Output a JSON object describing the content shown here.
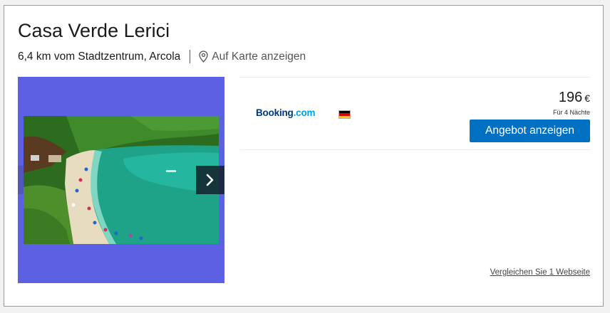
{
  "hotel": {
    "name": "Casa Verde Lerici",
    "distance_text": "6,4 km vom Stadtzentrum, Arcola",
    "map_link_label": "Auf Karte anzeigen"
  },
  "gallery": {
    "background_color": "#5c60e3",
    "next_icon": "chevron-right-icon"
  },
  "deal": {
    "provider_part1": "Booking",
    "provider_part2": ".com",
    "provider_colors": {
      "part1": "#003580",
      "part2": "#009fe3"
    },
    "flag": "germany-flag-icon",
    "price": "196",
    "currency": "€",
    "nights_note": "Für 4 Nächte",
    "cta_label": "Angebot anzeigen",
    "cta_color": "#0071c2"
  },
  "compare_link": "Vergleichen Sie 1 Webseite"
}
